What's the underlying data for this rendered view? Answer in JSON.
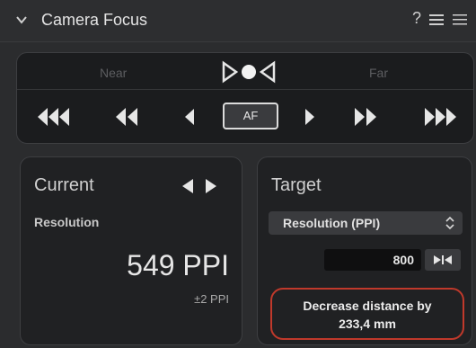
{
  "header": {
    "title": "Camera Focus",
    "help_glyph": "?",
    "icons": [
      "chevron-down-icon",
      "help-icon",
      "list-menu-icon",
      "more-icon"
    ]
  },
  "focus": {
    "near_label": "Near",
    "far_label": "Far",
    "af_label": "AF",
    "nav_buttons": [
      "step-back-large",
      "step-back-medium",
      "step-back-small",
      "step-forward-small",
      "step-forward-medium",
      "step-forward-large"
    ]
  },
  "current": {
    "title": "Current",
    "resolution_label": "Resolution",
    "value": "549 PPI",
    "tolerance": "±2 PPI"
  },
  "target": {
    "title": "Target",
    "select_value": "Resolution (PPI)",
    "input_value": "800",
    "advice_line1": "Decrease distance by",
    "advice_line2": "233,4 mm"
  },
  "colors": {
    "background": "#2b2c2e",
    "panel": "#1b1c1e",
    "advice_border": "#c0392b"
  }
}
